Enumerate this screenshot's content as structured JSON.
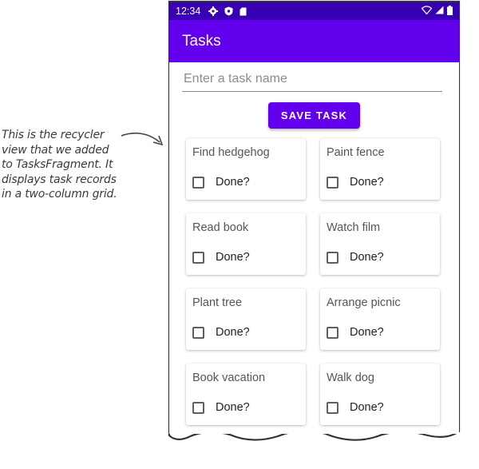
{
  "annotation": {
    "lines": [
      "This is the recycler",
      "view that we added",
      "to TasksFragment. It",
      "displays task records",
      "in a two-column grid."
    ]
  },
  "status_bar": {
    "time": "12:34",
    "icons": [
      "settings-icon",
      "shield-icon",
      "sd-card-icon"
    ],
    "right_icons": [
      "wifi-icon",
      "signal-icon",
      "battery-icon"
    ]
  },
  "app_bar": {
    "title": "Tasks"
  },
  "form": {
    "placeholder": "Enter a task name",
    "value": "",
    "save_label": "SAVE TASK"
  },
  "tasks": [
    {
      "name": "Find hedgehog",
      "done_label": "Done?",
      "done": false
    },
    {
      "name": "Paint fence",
      "done_label": "Done?",
      "done": false
    },
    {
      "name": "Read book",
      "done_label": "Done?",
      "done": false
    },
    {
      "name": "Watch film",
      "done_label": "Done?",
      "done": false
    },
    {
      "name": "Plant tree",
      "done_label": "Done?",
      "done": false
    },
    {
      "name": "Arrange picnic",
      "done_label": "Done?",
      "done": false
    },
    {
      "name": "Book vacation",
      "done_label": "Done?",
      "done": false
    },
    {
      "name": "Walk dog",
      "done_label": "Done?",
      "done": false
    }
  ],
  "colors": {
    "status_bar": "#3700b3",
    "primary": "#6200ee"
  }
}
